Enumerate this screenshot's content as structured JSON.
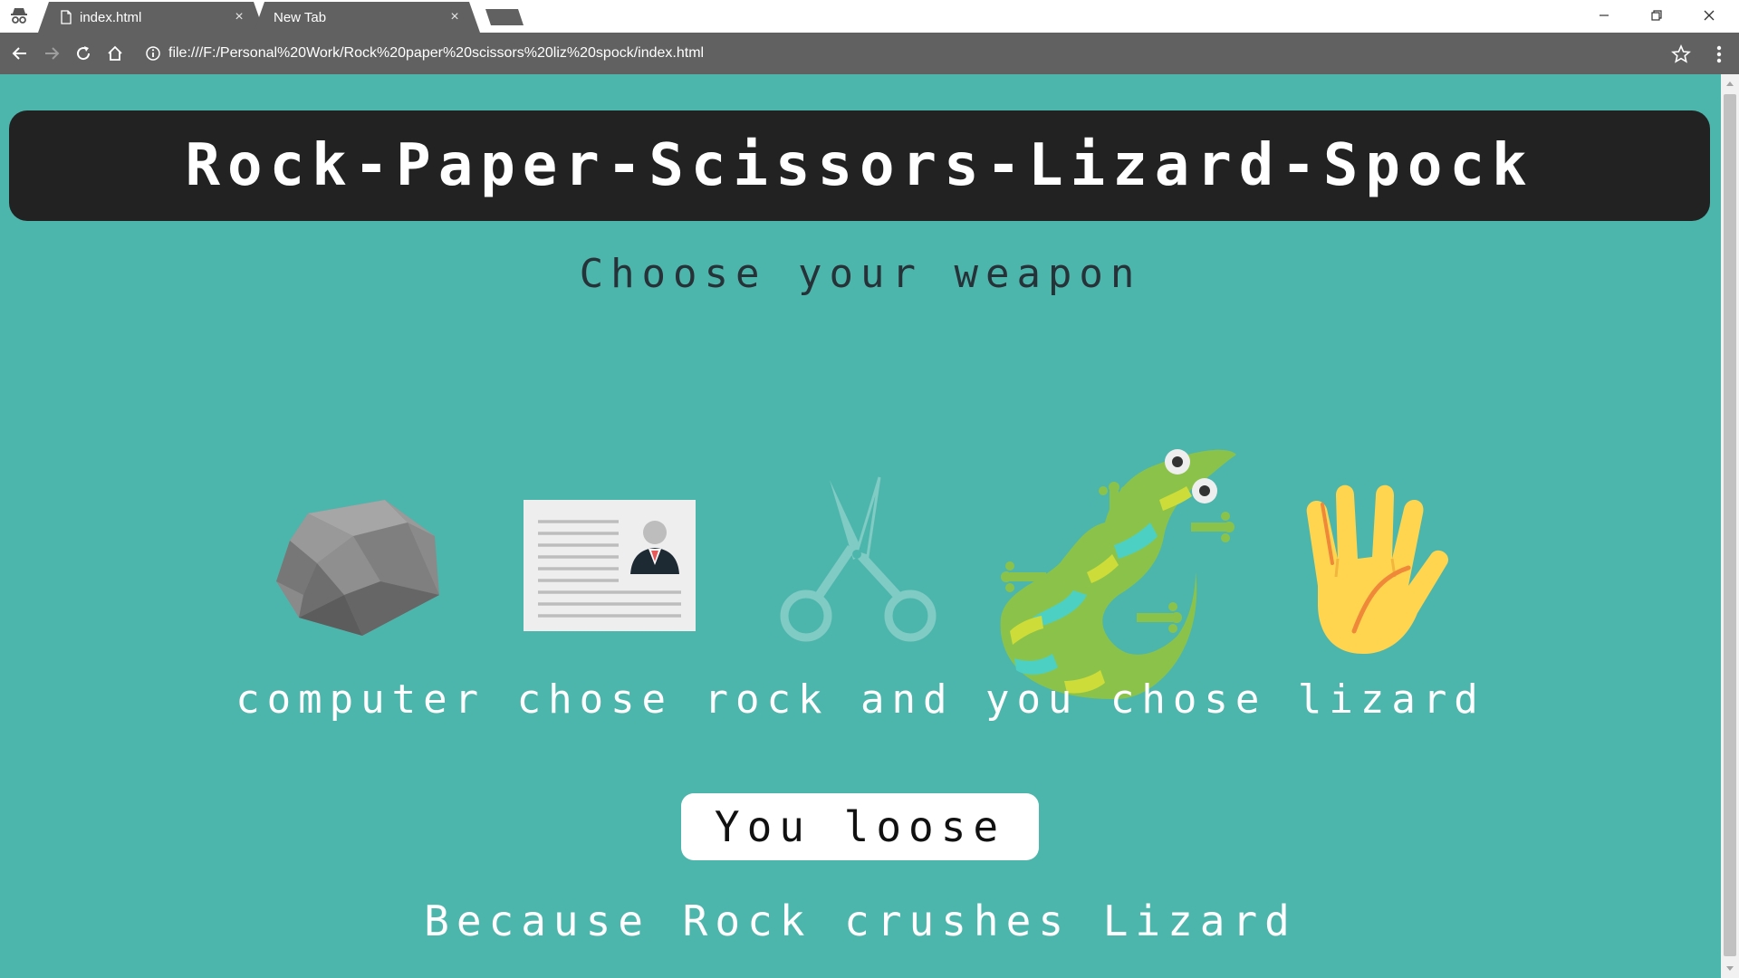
{
  "browser": {
    "tabs": [
      {
        "title": "index.html",
        "active": true
      },
      {
        "title": "New Tab",
        "active": false
      }
    ],
    "url": "file:///F:/Personal%20Work/Rock%20paper%20scissors%20liz%20spock/index.html",
    "close_glyph": "×",
    "colors": {
      "tabstrip": "#ffffff",
      "active_tab": "#616161",
      "inactive_tab": "#616161",
      "toolbar": "#616161"
    }
  },
  "page": {
    "title": "Rock-Paper-Scissors-Lizard-Spock",
    "subtitle": "Choose your weapon",
    "weapons": [
      {
        "name": "rock",
        "icon": "rock-icon"
      },
      {
        "name": "paper",
        "icon": "paper-icon"
      },
      {
        "name": "scissors",
        "icon": "scissors-icon"
      },
      {
        "name": "lizard",
        "icon": "lizard-icon"
      },
      {
        "name": "spock",
        "icon": "vulcan-salute-icon"
      }
    ],
    "result_line": "computer chose rock and you chose lizard",
    "verdict": "You loose",
    "reason": "Because Rock crushes Lizard",
    "colors": {
      "background": "#4db6ac",
      "title_bar": "#222222",
      "subtitle_text": "#263238",
      "verdict_box": "#ffffff"
    }
  }
}
